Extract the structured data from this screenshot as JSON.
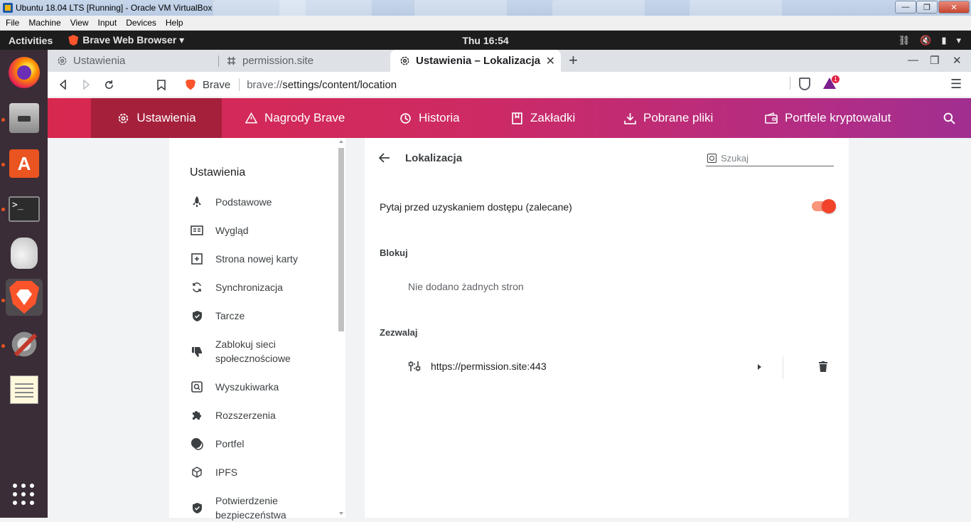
{
  "vbox": {
    "title": "Ubuntu 18.04 LTS [Running] - Oracle VM VirtualBox",
    "menu": [
      "File",
      "Machine",
      "View",
      "Input",
      "Devices",
      "Help"
    ]
  },
  "gnome": {
    "activities": "Activities",
    "app_menu": "Brave Web Browser ▾",
    "clock": "Thu 16:54"
  },
  "browser": {
    "tabs": [
      {
        "label": "Ustawienia",
        "icon": "gear-icon"
      },
      {
        "label": "permission.site",
        "icon": "hash-icon"
      },
      {
        "label": "Ustawienia – Lokalizacja",
        "icon": "gear-icon"
      }
    ],
    "url": {
      "label": "Brave",
      "scheme": "brave://",
      "path": "settings/content/location"
    },
    "rewards_badge": "1"
  },
  "settings_nav": {
    "items": [
      {
        "label": "Ustawienia",
        "icon": "gear-icon"
      },
      {
        "label": "Nagrody Brave",
        "icon": "warning-triangle-icon"
      },
      {
        "label": "Historia",
        "icon": "history-icon"
      },
      {
        "label": "Zakładki",
        "icon": "bookmark-icon"
      },
      {
        "label": "Pobrane pliki",
        "icon": "download-icon"
      },
      {
        "label": "Portfele kryptowalut",
        "icon": "wallet-icon"
      }
    ]
  },
  "sidebar": {
    "title": "Ustawienia",
    "items": [
      {
        "label": "Podstawowe",
        "icon": "rocket-icon"
      },
      {
        "label": "Wygląd",
        "icon": "appearance-icon"
      },
      {
        "label": "Strona nowej karty",
        "icon": "new-tab-icon"
      },
      {
        "label": "Synchronizacja",
        "icon": "sync-icon"
      },
      {
        "label": "Tarcze",
        "icon": "shield-icon"
      },
      {
        "label": "Zablokuj sieci",
        "label2": "społecznościowe",
        "icon": "thumbs-down-icon"
      },
      {
        "label": "Wyszukiwarka",
        "icon": "search-icon"
      },
      {
        "label": "Rozszerzenia",
        "icon": "puzzle-icon"
      },
      {
        "label": "Portfel",
        "icon": "wallet-icon"
      },
      {
        "label": "IPFS",
        "icon": "cube-icon"
      },
      {
        "label": "Potwierdzenie",
        "label2": "bezpieczeństwa",
        "icon": "shield-check-icon"
      }
    ]
  },
  "panel": {
    "title": "Lokalizacja",
    "search_placeholder": "Szukaj",
    "ask_label": "Pytaj przed uzyskaniem dostępu (zalecane)",
    "ask_enabled": true,
    "block_label": "Blokuj",
    "block_empty": "Nie dodano żadnych stron",
    "allow_label": "Zezwalaj",
    "allow_sites": [
      {
        "url": "https://permission.site:443"
      }
    ]
  },
  "colors": {
    "brand": "#fb542b",
    "nav_start": "#d7284f",
    "nav_end": "#a02f90",
    "toggle_on": "#f2432a"
  }
}
